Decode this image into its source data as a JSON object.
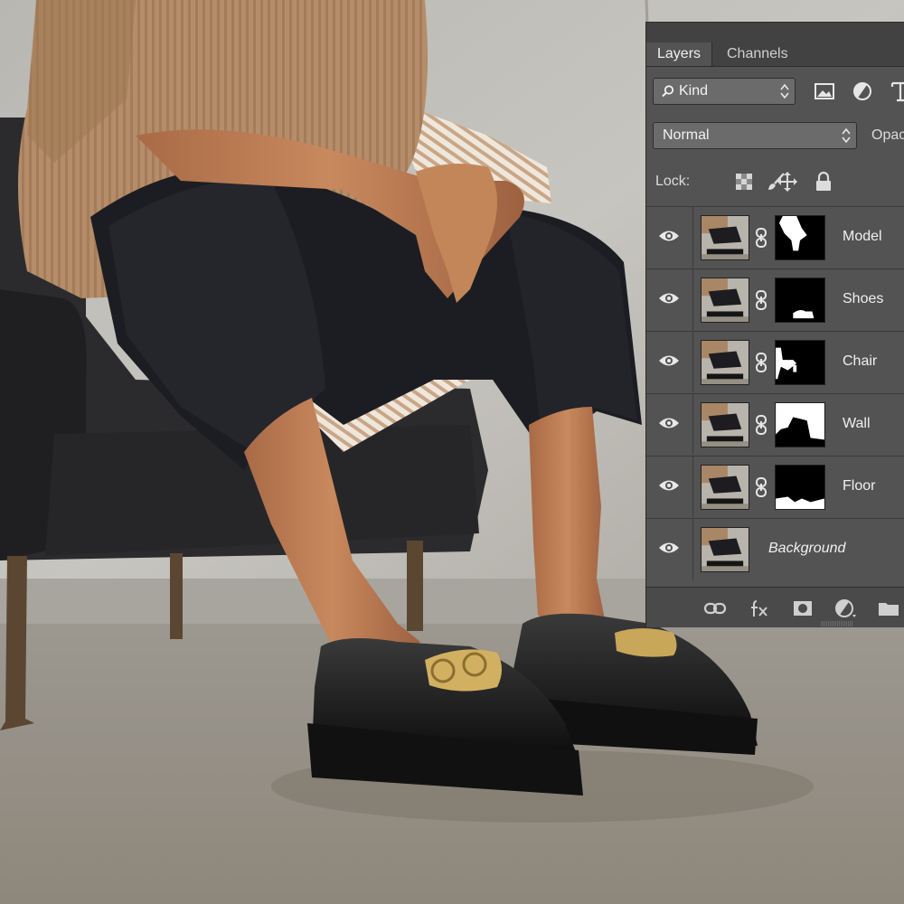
{
  "panel": {
    "tabs": [
      {
        "label": "Layers",
        "active": true
      },
      {
        "label": "Channels",
        "active": false
      }
    ],
    "filter": {
      "kind_value": "Kind",
      "icons": [
        "image-filter-icon",
        "adjustment-filter-icon",
        "type-filter-icon"
      ]
    },
    "blend_mode": "Normal",
    "opacity_label": "Opac",
    "lock_label": "Lock:",
    "lock_icons": [
      "lock-transparent-pixels-icon",
      "lock-image-pixels-icon",
      "lock-position-icon",
      "lock-all-icon"
    ],
    "layers": [
      {
        "name": "Model",
        "visible": true,
        "has_mask": true
      },
      {
        "name": "Shoes",
        "visible": true,
        "has_mask": true
      },
      {
        "name": "Chair",
        "visible": true,
        "has_mask": true
      },
      {
        "name": "Wall",
        "visible": true,
        "has_mask": true
      },
      {
        "name": "Floor",
        "visible": true,
        "has_mask": true
      },
      {
        "name": "Background",
        "visible": true,
        "has_mask": false
      }
    ],
    "bottom_icons": [
      "link-layers-icon",
      "fx-icon",
      "add-mask-icon",
      "adjustment-layer-icon",
      "new-group-icon"
    ]
  },
  "colors": {
    "panel_bg": "#535353",
    "tab_bar_bg": "#424242",
    "control_bg": "#6b6b6b",
    "text": "#e4e4e4"
  }
}
